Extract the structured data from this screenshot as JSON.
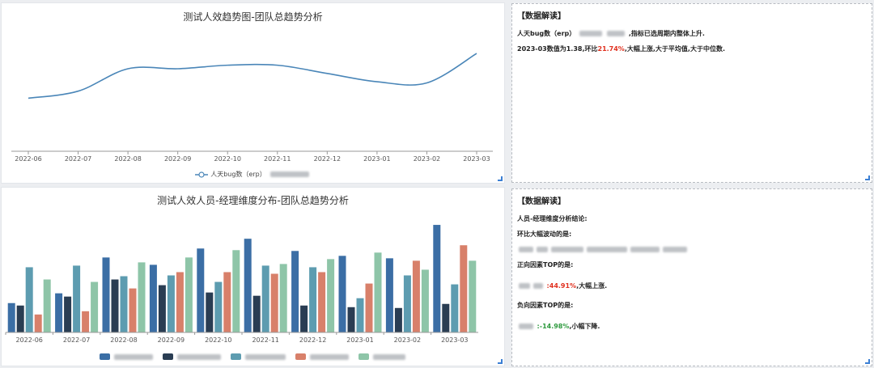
{
  "top_chart": {
    "title": "测试人效趋势图-团队总趋势分析",
    "legend_label": "人天bug数（erp）"
  },
  "top_info": {
    "heading": "【数据解读】",
    "line1_prefix": "人天bug数（erp）",
    "line1_suffix": ",指标已选周期内整体上升.",
    "line2_a": "2023-03数值为1.38,环比",
    "line2_pct": "21.74%",
    "line2_b": ",大幅上涨,大于平均值,大于中位数."
  },
  "bottom_chart": {
    "title": "测试人效人员-经理维度分布-团队总趋势分析"
  },
  "bottom_info": {
    "heading": "【数据解读】",
    "l1": "人员-经理维度分析结论:",
    "l2": "环比大幅波动的是:",
    "l3": "正向因素TOP的是:",
    "l4_pct": ":44.91%",
    "l4_suffix": ",大幅上涨.",
    "l5": "负向因素TOP的是:",
    "l6_pct": ":-14.98%",
    "l6_suffix": ",小幅下降."
  },
  "chart_data": [
    {
      "type": "line",
      "x": [
        "2022-06",
        "2022-07",
        "2022-08",
        "2022-09",
        "2022-10",
        "2022-11",
        "2022-12",
        "2023-01",
        "2023-02",
        "2023-03"
      ],
      "series": [
        {
          "values": [
            1.0,
            1.06,
            1.25,
            1.25,
            1.28,
            1.28,
            1.21,
            1.14,
            1.13,
            1.38
          ]
        }
      ],
      "ylim": [
        0.55,
        1.6
      ],
      "color": "#4a86b8"
    },
    {
      "type": "bar",
      "categories": [
        "2022-06",
        "2022-07",
        "2022-08",
        "2022-09",
        "2022-10",
        "2022-11",
        "2022-12",
        "2023-01",
        "2023-02",
        "2023-03"
      ],
      "series": [
        {
          "values": [
            36,
            48,
            92,
            83,
            103,
            115,
            100,
            94,
            91,
            132
          ],
          "color": "#3b6ea5"
        },
        {
          "values": [
            33,
            44,
            65,
            58,
            49,
            45,
            33,
            31,
            30,
            35
          ],
          "color": "#2a3d53"
        },
        {
          "values": [
            80,
            82,
            69,
            70,
            62,
            82,
            80,
            42,
            70,
            59
          ],
          "color": "#5d9cb0"
        },
        {
          "values": [
            22,
            26,
            54,
            74,
            74,
            72,
            74,
            60,
            88,
            107
          ],
          "color": "#d8806a"
        },
        {
          "values": [
            65,
            62,
            86,
            92,
            101,
            84,
            90,
            98,
            77,
            88
          ],
          "color": "#8ec5a8"
        }
      ],
      "ymax": 140
    }
  ]
}
